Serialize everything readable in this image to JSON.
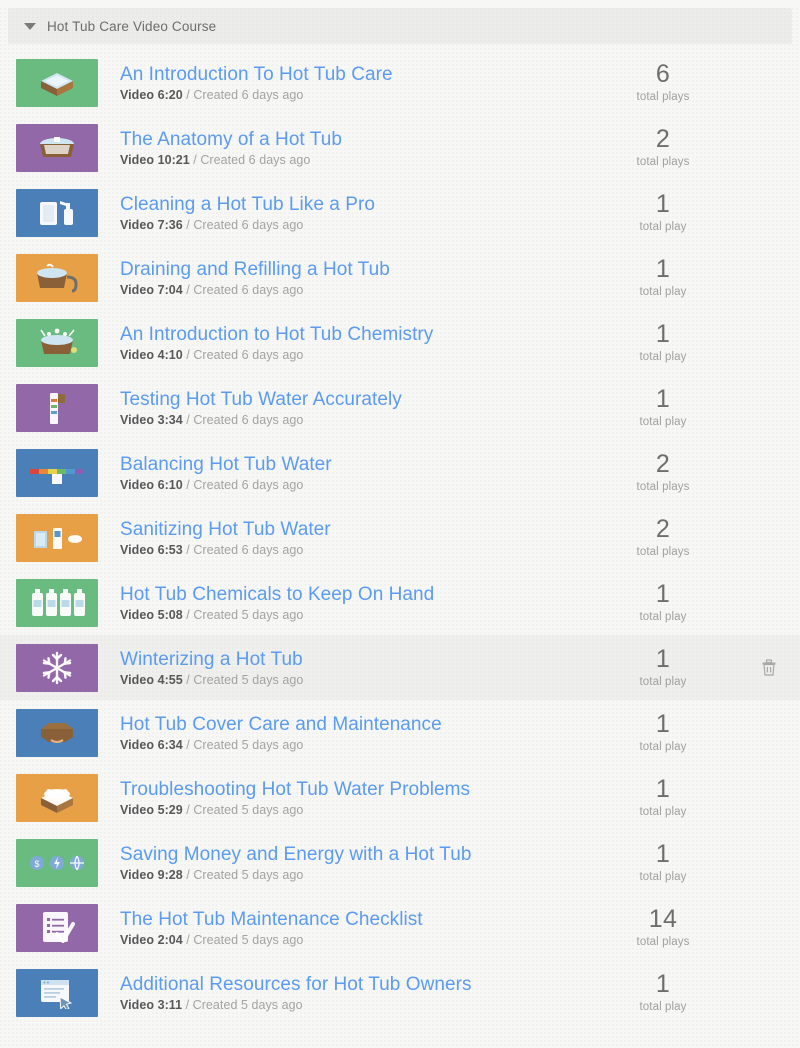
{
  "course": {
    "title": "Hot Tub Care Video Course",
    "collapse_icon": "caret-down-icon",
    "expanded": true
  },
  "colors": {
    "page_background": "#f7f7f5",
    "header_background": "#ececea",
    "row_hover_background": "#efefed",
    "title_link": "#5b9bf0",
    "duration_text": "#58585a",
    "created_text": "#a3a3a1",
    "count_text": "#6e6e6c",
    "count_label_text": "#a0a09e",
    "thumb_green": "#6abb80",
    "thumb_purple": "#9268a8",
    "thumb_blue": "#4a7fb8",
    "thumb_orange": "#e8a046"
  },
  "delete_action": {
    "icon": "trash-icon",
    "label": "Delete"
  },
  "videos": [
    {
      "title": "An Introduction To Hot Tub Care",
      "duration": "Video 6:20",
      "created": "/ Created 6 days ago",
      "plays": "6",
      "plays_label": "total plays",
      "thumb_color": "#6abb80",
      "thumb_icon": "hot-tub-icon",
      "hovered": false
    },
    {
      "title": "The Anatomy of a Hot Tub",
      "duration": "Video 10:21",
      "created": "/ Created 6 days ago",
      "plays": "2",
      "plays_label": "total plays",
      "thumb_color": "#9268a8",
      "thumb_icon": "hot-tub-cutaway-icon",
      "hovered": false
    },
    {
      "title": "Cleaning a Hot Tub Like a Pro",
      "duration": "Video 7:36",
      "created": "/ Created 6 days ago",
      "plays": "1",
      "plays_label": "total play",
      "thumb_color": "#4a7fb8",
      "thumb_icon": "sponge-and-spray-bottle-icon",
      "hovered": false
    },
    {
      "title": "Draining and Refilling a Hot Tub",
      "duration": "Video 7:04",
      "created": "/ Created 6 days ago",
      "plays": "1",
      "plays_label": "total play",
      "thumb_color": "#e8a046",
      "thumb_icon": "draining-tub-hose-icon",
      "hovered": false
    },
    {
      "title": "An Introduction to Hot Tub Chemistry",
      "duration": "Video 4:10",
      "created": "/ Created 6 days ago",
      "plays": "1",
      "plays_label": "total play",
      "thumb_color": "#6abb80",
      "thumb_icon": "bubbling-tub-icon",
      "hovered": false
    },
    {
      "title": "Testing Hot Tub Water Accurately",
      "duration": "Video 3:34",
      "created": "/ Created 6 days ago",
      "plays": "1",
      "plays_label": "total play",
      "thumb_color": "#9268a8",
      "thumb_icon": "test-strip-icon",
      "hovered": false
    },
    {
      "title": "Balancing Hot Tub Water",
      "duration": "Video 6:10",
      "created": "/ Created 6 days ago",
      "plays": "2",
      "plays_label": "total plays",
      "thumb_color": "#4a7fb8",
      "thumb_icon": "ph-scale-icon",
      "hovered": false
    },
    {
      "title": "Sanitizing Hot Tub Water",
      "duration": "Video 6:53",
      "created": "/ Created 6 days ago",
      "plays": "2",
      "plays_label": "total plays",
      "thumb_color": "#e8a046",
      "thumb_icon": "sanitizer-products-icon",
      "hovered": false
    },
    {
      "title": "Hot Tub Chemicals to Keep On Hand",
      "duration": "Video 5:08",
      "created": "/ Created 5 days ago",
      "plays": "1",
      "plays_label": "total play",
      "thumb_color": "#6abb80",
      "thumb_icon": "chemical-bottles-icon",
      "hovered": false
    },
    {
      "title": "Winterizing a Hot Tub",
      "duration": "Video 4:55",
      "created": "/ Created 5 days ago",
      "plays": "1",
      "plays_label": "total play",
      "thumb_color": "#9268a8",
      "thumb_icon": "snowflake-icon",
      "hovered": true
    },
    {
      "title": "Hot Tub Cover Care and Maintenance",
      "duration": "Video 6:34",
      "created": "/ Created 5 days ago",
      "plays": "1",
      "plays_label": "total play",
      "thumb_color": "#4a7fb8",
      "thumb_icon": "tub-cover-icon",
      "hovered": false
    },
    {
      "title": "Troubleshooting Hot Tub Water Problems",
      "duration": "Video 5:29",
      "created": "/ Created 5 days ago",
      "plays": "1",
      "plays_label": "total play",
      "thumb_color": "#e8a046",
      "thumb_icon": "foamy-tub-icon",
      "hovered": false
    },
    {
      "title": "Saving Money and Energy with a Hot Tub",
      "duration": "Video 9:28",
      "created": "/ Created 5 days ago",
      "plays": "1",
      "plays_label": "total play",
      "thumb_color": "#6abb80",
      "thumb_icon": "energy-coins-icon",
      "hovered": false
    },
    {
      "title": "The Hot Tub Maintenance Checklist",
      "duration": "Video 2:04",
      "created": "/ Created 5 days ago",
      "plays": "14",
      "plays_label": "total plays",
      "thumb_color": "#9268a8",
      "thumb_icon": "checklist-icon",
      "hovered": false
    },
    {
      "title": "Additional Resources for Hot Tub Owners",
      "duration": "Video 3:11",
      "created": "/ Created 5 days ago",
      "plays": "1",
      "plays_label": "total play",
      "thumb_color": "#4a7fb8",
      "thumb_icon": "browser-window-icon",
      "hovered": false
    }
  ]
}
